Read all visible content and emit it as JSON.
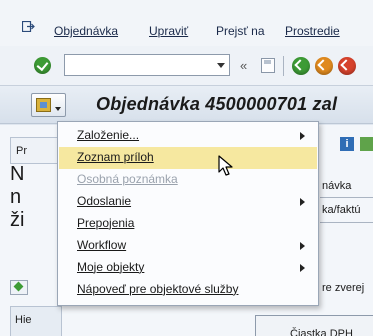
{
  "menubar": {
    "exit_icon": "exit-door-icon",
    "items": [
      "Objednávka",
      "Upraviť",
      "Prejsť na",
      "Prostredie"
    ]
  },
  "toolbar": {
    "command_value": "",
    "back_glyph": "«",
    "icons": [
      "ok-check-icon",
      "command-dropdown-icon",
      "save-icon",
      "back-green-icon",
      "exit-orange-icon",
      "cancel-red-icon"
    ]
  },
  "title": {
    "menu_icon": "object-services-icon",
    "text": "Objednávka 4500000701 zal"
  },
  "background": {
    "tab_label": "Pr",
    "big_text": [
      "N",
      "n",
      "ži"
    ],
    "right_labels": [
      "návka",
      "ka/faktú",
      "re zverej"
    ],
    "hie_tab": "Hie",
    "bottom_label": "Čiastka DPH"
  },
  "popup": {
    "items": [
      {
        "label": "Založenie...",
        "submenu": true,
        "disabled": false,
        "hover": false
      },
      {
        "label": "Zoznam príloh",
        "submenu": false,
        "disabled": false,
        "hover": true
      },
      {
        "label": "Osobná poznámka",
        "submenu": false,
        "disabled": true,
        "hover": false
      },
      {
        "label": "Odoslanie",
        "submenu": true,
        "disabled": false,
        "hover": false
      },
      {
        "label": "Prepojenia",
        "submenu": false,
        "disabled": false,
        "hover": false
      },
      {
        "label": "Workflow",
        "submenu": true,
        "disabled": false,
        "hover": false
      },
      {
        "label": "Moje objekty",
        "submenu": true,
        "disabled": false,
        "hover": false
      },
      {
        "label": "Nápoveď pre objektové služby",
        "submenu": false,
        "disabled": false,
        "hover": false
      }
    ]
  },
  "colors": {
    "hover_bg": "#f6e8a0",
    "ok_green": "#3d9b35",
    "back_green": "#3d9b35",
    "exit_orange": "#e08a1e",
    "cancel_red": "#d6422c"
  }
}
